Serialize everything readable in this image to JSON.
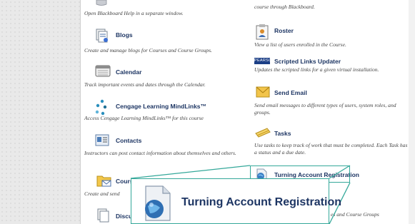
{
  "left_column": {
    "help": {
      "desc": "Open Blackboard Help in a separate window."
    },
    "blogs": {
      "title": "Blogs",
      "desc": "Create and manage blogs for Courses and Course Groups."
    },
    "calendar": {
      "title": "Calendar",
      "desc": "Track important events and dates through the Calendar."
    },
    "cengage": {
      "title": "Cengage Learning MindLinks™",
      "desc": "Access Cengage Learning MindLinks™ for this course"
    },
    "contacts": {
      "title": "Contacts",
      "desc": "Instructors can post contact information about themselves and others."
    },
    "course_messages": {
      "title": "Cours",
      "desc": "Create and send"
    },
    "discussion": {
      "title": "Discu"
    }
  },
  "right_column": {
    "top_fragment": {
      "desc": "course through Blackboard."
    },
    "roster": {
      "title": "Roster",
      "desc": "View a list of users enrolled in the Course."
    },
    "scripted": {
      "logo": "PEARSON",
      "title": "Scripted Links Updater",
      "desc": "Updates the scripted links for a given virtual installation."
    },
    "send_email": {
      "title": "Send Email",
      "desc": "Send email messages to different types of users, system roles, and groups."
    },
    "tasks": {
      "title": "Tasks",
      "desc": "Use tasks to keep track of work that must be completed. Each Task has a status and a due date."
    },
    "turning": {
      "title": "Turning Account Registration"
    },
    "bottom_fragment": {
      "desc": "es and Course Groups"
    }
  },
  "callout": {
    "label": "Turning Account Registration"
  },
  "colors": {
    "accent": "#34a89a",
    "link": "#1d3563"
  }
}
